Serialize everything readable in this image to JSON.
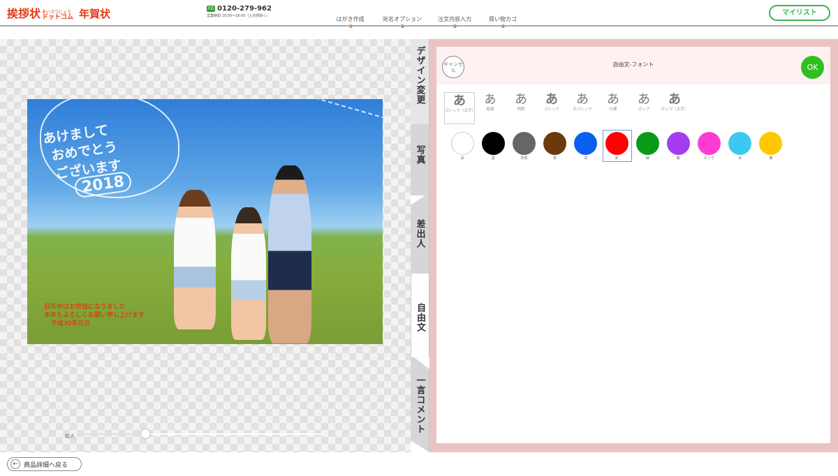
{
  "header": {
    "logo_main": "挨拶状",
    "logo_small": "あいさつじょう",
    "logo_dot": "ドットコム",
    "logo_nenga": "年賀状",
    "phone_badge": "フリーダイヤル",
    "phone_number": "0120-279-962",
    "phone_hours": "営業時間 10:00～18:00（土日祝除く）",
    "steps": [
      {
        "label": "はがき作成",
        "active": true
      },
      {
        "label": "宛名オプション",
        "active": false
      },
      {
        "label": "注文内容入力",
        "active": false
      },
      {
        "label": "買い物カゴ",
        "active": false
      }
    ],
    "mylist_label": "マイリスト"
  },
  "card": {
    "greeting_line1": "あけまして",
    "greeting_line2": "おめでとう",
    "greeting_line3": "ございます",
    "greeting_year": "2018",
    "message_line1": "旧年中はお世話になりました",
    "message_line2": "本年もよろしくお願い申し上げます",
    "message_line3": "平成30年元旦",
    "message_color": "#ff1a00"
  },
  "zoom": {
    "label": "拡大",
    "value": 0.26
  },
  "tabs": [
    {
      "label": "デザイン変更"
    },
    {
      "label": "写真"
    },
    {
      "label": "差出人"
    },
    {
      "label": "自由文",
      "active": true
    },
    {
      "label": "一言コメント"
    }
  ],
  "panel": {
    "title": "自由文-フォント",
    "cancel_label": "キャンセル",
    "ok_label": "OK",
    "fonts": [
      {
        "glyph": "あ",
        "name": "ゴシック（太字）",
        "selected": true
      },
      {
        "glyph": "あ",
        "name": "楷書",
        "selected": false
      },
      {
        "glyph": "あ",
        "name": "明朝",
        "selected": false
      },
      {
        "glyph": "あ",
        "name": "ゴシック",
        "selected": false
      },
      {
        "glyph": "あ",
        "name": "丸ゴシック",
        "selected": false
      },
      {
        "glyph": "あ",
        "name": "行書",
        "selected": false
      },
      {
        "glyph": "あ",
        "name": "ポップ",
        "selected": false
      },
      {
        "glyph": "あ",
        "name": "ポップ（太字）",
        "selected": false
      }
    ],
    "colors": [
      {
        "name": "白",
        "hex": "#ffffff"
      },
      {
        "name": "黒",
        "hex": "#000000"
      },
      {
        "name": "灰色",
        "hex": "#666666"
      },
      {
        "name": "茶",
        "hex": "#6b3a0c"
      },
      {
        "name": "青",
        "hex": "#0a5ff0"
      },
      {
        "name": "赤",
        "hex": "#ff0000",
        "selected": true
      },
      {
        "name": "緑",
        "hex": "#0a9a1a"
      },
      {
        "name": "紫",
        "hex": "#a43cf0"
      },
      {
        "name": "ピンク",
        "hex": "#ff3cd2"
      },
      {
        "name": "水",
        "hex": "#3cc8f0"
      },
      {
        "name": "黄",
        "hex": "#ffc800"
      }
    ]
  },
  "footer": {
    "back_label": "商品詳細へ戻る"
  }
}
